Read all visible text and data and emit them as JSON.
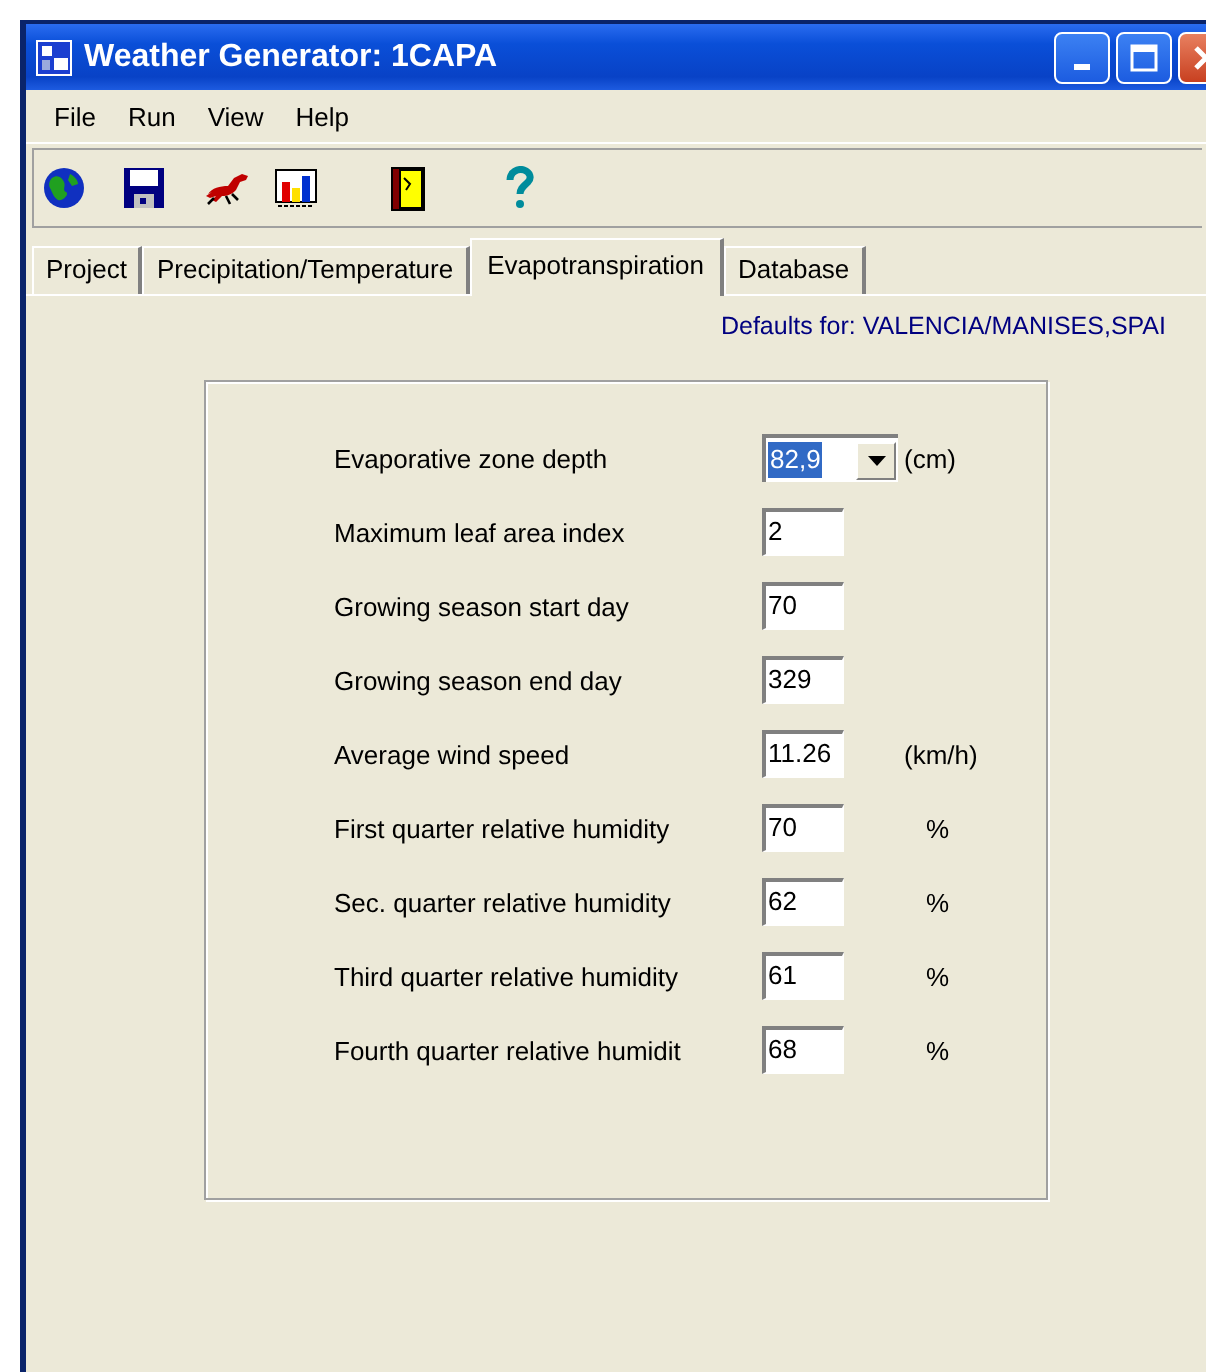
{
  "window": {
    "title": "Weather Generator: 1CAPA"
  },
  "menu": [
    "File",
    "Run",
    "View",
    "Help"
  ],
  "toolbar": [
    {
      "kind": "globe"
    },
    {
      "kind": "save"
    },
    {
      "kind": "horse"
    },
    {
      "kind": "chart"
    },
    {
      "kind": "door"
    },
    {
      "kind": "help"
    }
  ],
  "tabs": [
    {
      "label": "Project",
      "selected": false
    },
    {
      "label": "Precipitation/Temperature",
      "selected": false
    },
    {
      "label": "Evapotranspiration",
      "selected": true
    },
    {
      "label": "Database",
      "selected": false
    }
  ],
  "defaults_label": "Defaults for: VALENCIA/MANISES,SPAI",
  "fields": [
    {
      "kind": "combo",
      "label": "Evaporative zone depth",
      "value": "82,9",
      "selected": true,
      "unit": "(cm)"
    },
    {
      "kind": "text",
      "label": "Maximum leaf area index",
      "value": "2"
    },
    {
      "kind": "text",
      "label": "Growing season start day",
      "value": "70"
    },
    {
      "kind": "text",
      "label": "Growing season end day",
      "value": "329"
    },
    {
      "kind": "text",
      "label": "Average wind speed",
      "value": "11.26",
      "unit": "(km/h)"
    },
    {
      "kind": "text",
      "label": "First quarter relative humidity",
      "value": "70",
      "unit": "%"
    },
    {
      "kind": "text",
      "label": "Sec. quarter relative humidity",
      "value": "62",
      "unit": "%"
    },
    {
      "kind": "text",
      "label": "Third quarter relative humidity",
      "value": "61",
      "unit": "%"
    },
    {
      "kind": "text",
      "label": "Fourth quarter relative humidit",
      "value": "68",
      "unit": "%"
    }
  ]
}
